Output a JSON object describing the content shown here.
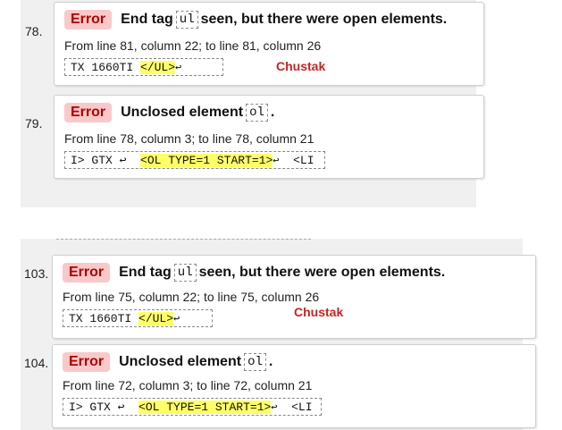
{
  "items": [
    {
      "number": "78.",
      "badge": "Error",
      "msg_before": "End tag",
      "code": "ul",
      "msg_after": "seen, but there were open elements.",
      "location": "From line 81, column 22; to line 81, column 26",
      "extract_pre": "TX 1660TI ",
      "extract_hl": "</UL>",
      "extract_post": "",
      "annotation": "Chustak"
    },
    {
      "number": "79.",
      "badge": "Error",
      "msg_before": "Unclosed element",
      "code": "ol",
      "msg_after": ".",
      "location": "From line 78, column 3; to line 78, column 21",
      "extract_pre": "I> GTX ↩  ",
      "extract_hl": "<OL TYPE=1 START=1>",
      "extract_post": "  <LI"
    },
    {
      "number": "103.",
      "badge": "Error",
      "msg_before": "End tag",
      "code": "ul",
      "msg_after": "seen, but there were open elements.",
      "location": "From line 75, column 22; to line 75, column 26",
      "extract_pre": "TX 1660TI ",
      "extract_hl": "</UL>",
      "extract_post": "",
      "annotation": "Chustak"
    },
    {
      "number": "104.",
      "badge": "Error",
      "msg_before": "Unclosed element",
      "code": "ol",
      "msg_after": ".",
      "location": "From line 72, column 3; to line 72, column 21",
      "extract_pre": "I> GTX ↩  ",
      "extract_hl": "<OL TYPE=1 START=1>",
      "extract_post": "  <LI"
    }
  ],
  "colors": {
    "badge_bg": "#f9c9c9",
    "badge_text": "#b00000",
    "highlight": "#ffff66",
    "annotation": "#d02020",
    "panel_bg": "#f0f0f0"
  },
  "icons": {
    "line_break": "return-arrow-icon"
  }
}
